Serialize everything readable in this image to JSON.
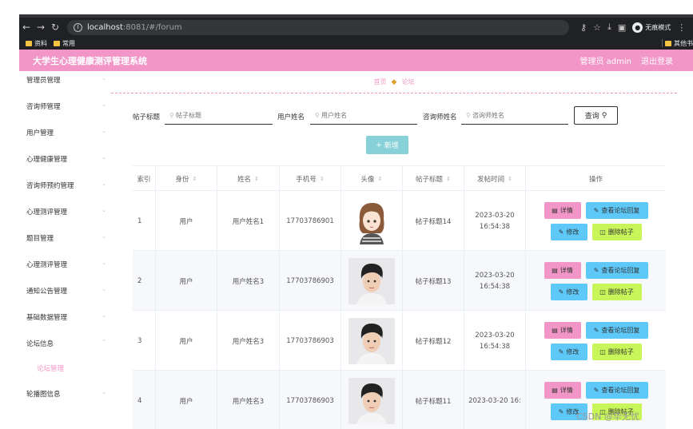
{
  "browser": {
    "url_host": "localhost",
    "url_rest": ":8081/#/forum",
    "incognito_label": "无痕模式",
    "bookmarks": [
      "资料",
      "常用"
    ],
    "bookmark_right": "其他书"
  },
  "header": {
    "title": "大学生心理健康测评管理系统",
    "user_label": "管理员 admin",
    "logout_label": "退出登录"
  },
  "sidebar": {
    "items": [
      {
        "label": "管理员管理"
      },
      {
        "label": "咨询师管理"
      },
      {
        "label": "用户管理"
      },
      {
        "label": "心理健康管理"
      },
      {
        "label": "咨询师预约管理"
      },
      {
        "label": "心理测评管理"
      },
      {
        "label": "题目管理"
      },
      {
        "label": "心理测评管理"
      },
      {
        "label": "通知公告管理"
      },
      {
        "label": "基础数据管理"
      },
      {
        "label": "论坛信息"
      },
      {
        "label": "轮播图信息"
      }
    ],
    "active_sub": "论坛管理"
  },
  "breadcrumb": {
    "home": "首页",
    "current": "论坛"
  },
  "search": {
    "title_label": "帖子标题",
    "title_placeholder": "帖子标题",
    "user_label": "用户姓名",
    "user_placeholder": "用户姓名",
    "counselor_label": "咨询师姓名",
    "counselor_placeholder": "咨询师姓名",
    "query_button": "查询"
  },
  "add_button": "新增",
  "table": {
    "columns": [
      "索引",
      "身份",
      "姓名",
      "手机号",
      "头像",
      "帖子标题",
      "发帖时间",
      "操作"
    ],
    "rows": [
      {
        "index": "1",
        "role": "用户",
        "name": "用户姓名1",
        "phone": "17703786901",
        "title": "帖子标题14",
        "time": "2023-03-20 16:54:38"
      },
      {
        "index": "2",
        "role": "用户",
        "name": "用户姓名3",
        "phone": "17703786903",
        "title": "帖子标题13",
        "time": "2023-03-20 16:54:38"
      },
      {
        "index": "3",
        "role": "用户",
        "name": "用户姓名3",
        "phone": "17703786903",
        "title": "帖子标题12",
        "time": "2023-03-20 16:54:38"
      },
      {
        "index": "4",
        "role": "用户",
        "name": "用户姓名3",
        "phone": "17703786903",
        "title": "帖子标题11",
        "time": "2023-03-20 16:"
      }
    ],
    "actions": {
      "detail": "详情",
      "reply": "查看论坛回复",
      "edit": "修改",
      "delete": "删除帖子"
    }
  },
  "watermark": "CSDN @毕无忧",
  "colors": {
    "accent_pink": "#f196c6",
    "add_teal": "#88d1d8",
    "btn_blue": "#5ec8f8",
    "btn_green": "#c8f55a"
  }
}
